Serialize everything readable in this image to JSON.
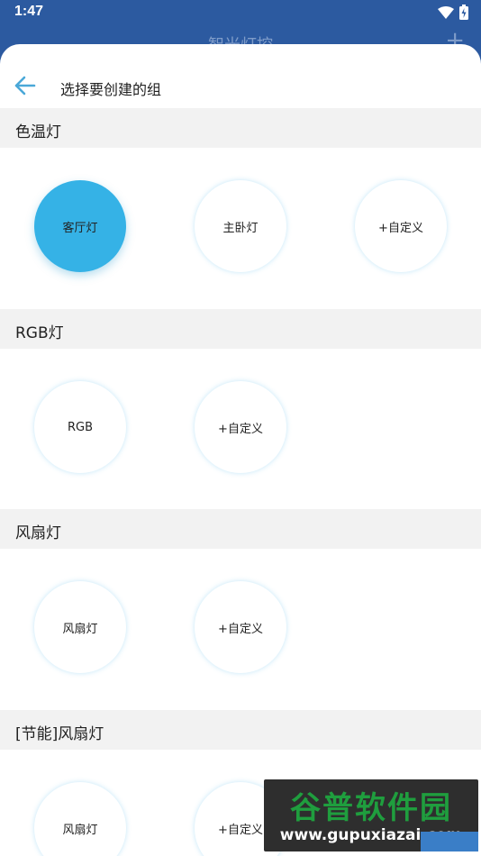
{
  "status": {
    "time": "1:47"
  },
  "behind": {
    "title": "智光灯控",
    "add_symbol": "+"
  },
  "sheet": {
    "title": "选择要创建的组"
  },
  "sections": [
    {
      "label": "色温灯",
      "items": [
        "客厅灯",
        "主卧灯",
        "+自定义"
      ]
    },
    {
      "label": "RGB灯",
      "items": [
        "RGB",
        "+自定义"
      ]
    },
    {
      "label": "风扇灯",
      "items": [
        "风扇灯",
        "+自定义"
      ]
    },
    {
      "label": "[节能]风扇灯",
      "items": [
        "风扇灯",
        "+自定义"
      ]
    }
  ],
  "selected": {
    "section": 0,
    "item": 0
  },
  "colors": {
    "accent": "#35b2e6",
    "header_bg": "#2c5aa0",
    "section_bg": "#f2f2f2"
  },
  "watermark": {
    "title": "谷普软件园",
    "url": "www.gupuxiazai.com"
  }
}
